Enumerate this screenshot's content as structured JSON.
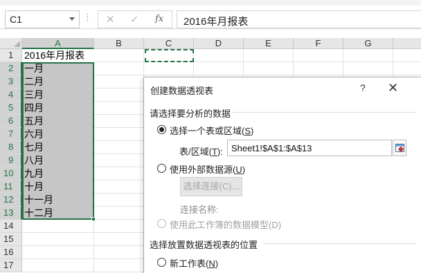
{
  "formula_bar": {
    "name_box": "C1",
    "cancel_icon": "✕",
    "enter_icon": "✓",
    "fx_label": "fx",
    "formula_value": "2016年月报表",
    "more_dots": "⋮"
  },
  "columns": [
    "A",
    "B",
    "C",
    "D",
    "E",
    "F",
    "G"
  ],
  "rows": [
    "1",
    "2",
    "3",
    "4",
    "5",
    "6",
    "7",
    "8",
    "9",
    "10",
    "11",
    "12",
    "13",
    "14",
    "15",
    "16",
    "17"
  ],
  "cells_a": [
    "2016年月报表",
    "一月",
    "二月",
    "三月",
    "四月",
    "五月",
    "六月",
    "七月",
    "八月",
    "九月",
    "十月",
    "十一月",
    "十二月"
  ],
  "dialog": {
    "title": "创建数据透视表",
    "help": "?",
    "close": "✕",
    "section1": "请选择要分析的数据",
    "opt_table_range": "选择一个表或区域(",
    "opt_table_range_key": "S",
    "opt_table_range_end": ")",
    "range_label": "表/区域(",
    "range_label_key": "T",
    "range_label_end": "):",
    "range_value": "Sheet1!$A$1:$A$13",
    "opt_external": "使用外部数据源(",
    "opt_external_key": "U",
    "opt_external_end": ")",
    "choose_connection": "选择连接(C)...",
    "connection_name": "连接名称:",
    "opt_data_model": "使用此工作簿的数据模型(D)",
    "section2": "选择放置数据透视表的位置",
    "opt_new_sheet": "新工作表(",
    "opt_new_sheet_key": "N",
    "opt_new_sheet_end": ")"
  },
  "colors": {
    "excel_green": "#217346",
    "selection_fill": "#c6c6c6"
  }
}
